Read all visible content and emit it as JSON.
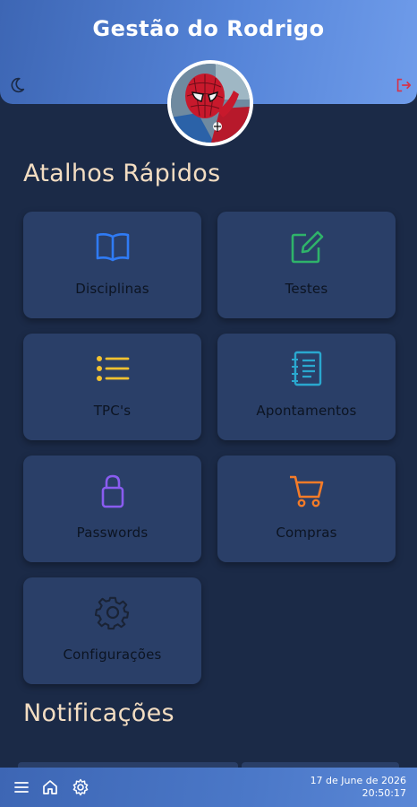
{
  "header": {
    "title": "Gestão do Rodrigo",
    "theme_icon": "moon-icon",
    "logout_icon": "logout-icon",
    "avatar_icon": "spiderman-avatar-icon"
  },
  "shortcuts": {
    "title": "Atalhos Rápidos",
    "items": [
      {
        "label": "Disciplinas",
        "icon": "book-icon",
        "color": "#2f7bf5"
      },
      {
        "label": "Testes",
        "icon": "edit-icon",
        "color": "#2fb36a"
      },
      {
        "label": "TPC's",
        "icon": "list-icon",
        "color": "#f2c230"
      },
      {
        "label": "Apontamentos",
        "icon": "notebook-icon",
        "color": "#2aa8cf"
      },
      {
        "label": "Passwords",
        "icon": "lock-icon",
        "color": "#8a5cf0"
      },
      {
        "label": "Compras",
        "icon": "cart-icon",
        "color": "#f47b28"
      },
      {
        "label": "Configurações",
        "icon": "gear-icon",
        "color": "#1a2335"
      }
    ]
  },
  "notifications": {
    "title": "Notificações"
  },
  "bottom_bar": {
    "menu_icon": "menu-icon",
    "home_icon": "home-icon",
    "settings_icon": "gear-icon",
    "date": "17 de June de 2026",
    "time": "20:50:17"
  }
}
